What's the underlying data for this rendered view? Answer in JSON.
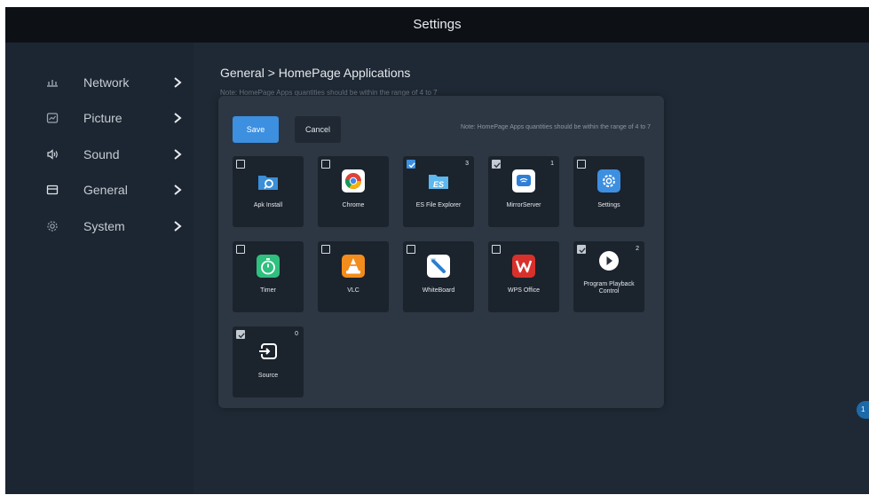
{
  "window": {
    "title": "Settings"
  },
  "sidebar": {
    "items": [
      {
        "label": "Network",
        "icon": "network-icon"
      },
      {
        "label": "Picture",
        "icon": "picture-icon"
      },
      {
        "label": "Sound",
        "icon": "sound-icon"
      },
      {
        "label": "General",
        "icon": "general-icon"
      },
      {
        "label": "System",
        "icon": "system-icon"
      }
    ]
  },
  "breadcrumb": {
    "text": "General  >  HomePage Applications"
  },
  "background_note": "Note: HomePage Apps quantities should be within the range of 4 to 7",
  "dialog": {
    "save_label": "Save",
    "cancel_label": "Cancel",
    "note": "Note: HomePage Apps quantities should be within the range of 4 to 7",
    "apps": [
      {
        "name": "Apk Install",
        "checked": false,
        "order": "",
        "icon": "apk-install-icon"
      },
      {
        "name": "Chrome",
        "checked": false,
        "order": "",
        "icon": "chrome-icon"
      },
      {
        "name": "ES File Explorer",
        "checked": true,
        "order": "3",
        "icon": "es-file-explorer-icon"
      },
      {
        "name": "MirrorServer",
        "checked": true,
        "order": "1",
        "icon": "mirrorserver-icon"
      },
      {
        "name": "Settings",
        "checked": false,
        "order": "",
        "icon": "settings-icon"
      },
      {
        "name": "Timer",
        "checked": false,
        "order": "",
        "icon": "timer-icon"
      },
      {
        "name": "VLC",
        "checked": false,
        "order": "",
        "icon": "vlc-icon"
      },
      {
        "name": "WhiteBoard",
        "checked": false,
        "order": "",
        "icon": "whiteboard-icon"
      },
      {
        "name": "WPS Office",
        "checked": false,
        "order": "",
        "icon": "wps-office-icon"
      },
      {
        "name": "Program Playback Control",
        "checked": true,
        "order": "2",
        "icon": "program-playback-icon"
      },
      {
        "name": "Source",
        "checked": true,
        "order": "0",
        "icon": "source-icon"
      }
    ]
  },
  "page_indicator": "1",
  "colors": {
    "accent": "#3d8fe0",
    "background": "#1f2935",
    "dialog": "#2c3743",
    "tile": "#1b232d"
  }
}
